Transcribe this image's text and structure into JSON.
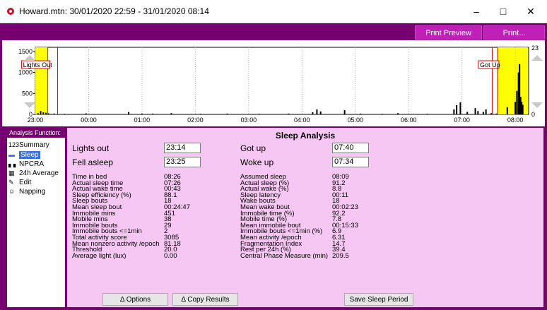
{
  "window": {
    "title": "Howard.mtn: 30/01/2020 22:59 - 31/01/2020 08:14",
    "minimize": "–",
    "maximize": "□",
    "close": "✕"
  },
  "toolbar": {
    "print_preview": "Print Preview",
    "print": "Print..."
  },
  "chart_data": {
    "type": "bar",
    "y_ticks_left": [
      "1500",
      "1000",
      "500",
      "0"
    ],
    "y_ticks_right": [
      "23",
      "0"
    ],
    "ylim": [
      0,
      1600
    ],
    "x_ticks": [
      "23:00",
      "00:00",
      "01:00",
      "02:00",
      "03:00",
      "04:00",
      "05:00",
      "06:00",
      "07:00",
      "08:00"
    ],
    "annotations": {
      "lights_out": "Lights Out",
      "got_up": "Got Up"
    },
    "light_periods": [
      {
        "start": "23:00",
        "end": "23:14"
      },
      {
        "start": "07:40",
        "end": "08:14"
      }
    ],
    "activity": [
      [
        23.05,
        30
      ],
      [
        23.1,
        80
      ],
      [
        23.15,
        50
      ],
      [
        23.2,
        40
      ],
      [
        23.25,
        25
      ],
      [
        23.35,
        20
      ],
      [
        23.55,
        15
      ],
      [
        23.95,
        25
      ],
      [
        0.75,
        55
      ],
      [
        1.0,
        20
      ],
      [
        1.2,
        20
      ],
      [
        1.55,
        30
      ],
      [
        2.1,
        15
      ],
      [
        2.6,
        20
      ],
      [
        3.2,
        15
      ],
      [
        3.75,
        20
      ],
      [
        4.2,
        50
      ],
      [
        4.28,
        120
      ],
      [
        4.35,
        70
      ],
      [
        4.8,
        100
      ],
      [
        5.1,
        20
      ],
      [
        5.5,
        15
      ],
      [
        5.8,
        30
      ],
      [
        6.35,
        15
      ],
      [
        6.85,
        120
      ],
      [
        6.9,
        220
      ],
      [
        6.97,
        290
      ],
      [
        7.1,
        60
      ],
      [
        7.25,
        150
      ],
      [
        7.3,
        80
      ],
      [
        7.4,
        60
      ],
      [
        7.45,
        120
      ],
      [
        7.55,
        30
      ],
      [
        7.65,
        20
      ],
      [
        7.85,
        170
      ],
      [
        8.0,
        300
      ],
      [
        8.03,
        560
      ],
      [
        8.06,
        1000
      ],
      [
        8.08,
        1200
      ],
      [
        8.1,
        420
      ],
      [
        8.12,
        300
      ],
      [
        8.14,
        230
      ]
    ]
  },
  "analysis_function": {
    "header": "Analysis Function:",
    "items": [
      {
        "icon": "123",
        "label": "Summary"
      },
      {
        "icon": "▬",
        "label": "Sleep"
      },
      {
        "icon": "▖▖",
        "label": "NPCRA"
      },
      {
        "icon": "▦",
        "label": "24h Average"
      },
      {
        "icon": "✎",
        "label": "Edit"
      },
      {
        "icon": "☺",
        "label": "Napping"
      }
    ]
  },
  "sleep_analysis": {
    "title": "Sleep Analysis",
    "lights_out_label": "Lights out",
    "lights_out_value": "23:14",
    "fell_asleep_label": "Fell asleep",
    "fell_asleep_value": "23:25",
    "got_up_label": "Got up",
    "got_up_value": "07:40",
    "woke_up_label": "Woke up",
    "woke_up_value": "07:34",
    "left_labels": [
      "Time in bed",
      "Actual sleep time",
      "Actual wake time",
      "Sleep efficiency (%)",
      "Sleep bouts",
      "Mean sleep bout",
      "Immobile mins",
      "Mobile mins",
      "Immobile bouts",
      "Immobile bouts <=1min",
      "Total activity score",
      "Mean nonzero activity /epoch",
      "Threshold",
      "Average light (lux)"
    ],
    "left_values": [
      "08:26",
      "07:26",
      "00:43",
      "88.1",
      "18",
      "00:24:47",
      "451",
      "38",
      "29",
      "2",
      "3085",
      "81.18",
      "20.0",
      "0.00"
    ],
    "right_labels": [
      "Assumed sleep",
      "Actual sleep (%)",
      "Actual wake (%)",
      "Sleep latency",
      "Wake bouts",
      "Mean wake bout",
      "Immobile time (%)",
      "Mobile time (%)",
      "Mean immobile bout",
      "Immobile bouts <=1min (%)",
      "Mean activity /epoch",
      "Fragmentation Index",
      "Rest per 24h (%)",
      "Central Phase Measure (min)"
    ],
    "right_values": [
      "08:09",
      "91.2",
      "8.8",
      "00:11",
      "18",
      "00:02:23",
      "92.2",
      "7.8",
      "00:15:33",
      "6.9",
      "6.31",
      "14.7",
      "39.4",
      "209.5"
    ]
  },
  "buttons": {
    "options": "Δ Options",
    "copy_results": "Δ Copy Results",
    "save_sleep_period": "Save Sleep Period"
  }
}
